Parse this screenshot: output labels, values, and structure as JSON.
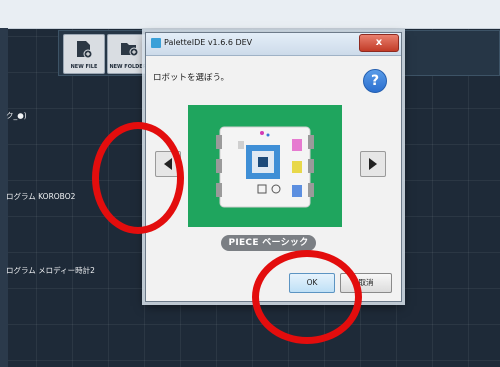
{
  "ide": {
    "toolbar": {
      "new_file_label": "NEW FILE",
      "new_folder_label": "NEW FOLDER"
    },
    "programs": [
      {
        "label": "ク_●)"
      },
      {
        "label": "ログラム KOROBO2"
      },
      {
        "label": "ログラム メロディー時計2"
      }
    ]
  },
  "dialog": {
    "title": "PaletteIDE v1.6.6 DEV",
    "close_glyph": "x",
    "prompt": "ロボットを選ぼう。",
    "help_glyph": "?",
    "robot_name": "PIECE ベーシック",
    "ok_label": "OK",
    "cancel_label": "取消"
  },
  "colors": {
    "annotation": "#e30d0d",
    "robot_panel": "#1fa55e",
    "ide_background": "#1e2a38"
  }
}
